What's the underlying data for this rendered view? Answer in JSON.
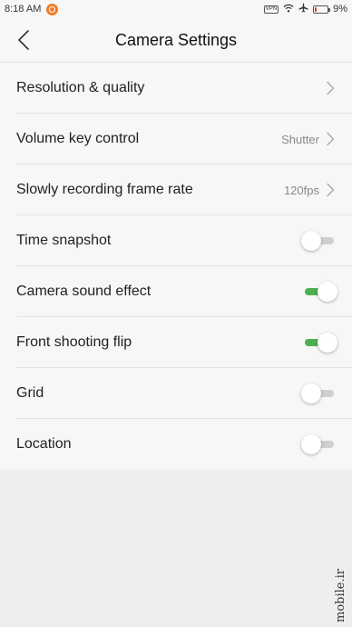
{
  "status_bar": {
    "time": "8:18 AM",
    "vpn_label": "VPN",
    "battery_percent": "9%",
    "battery_level": 0.09,
    "icons": [
      "notification-icon",
      "vpn-icon",
      "wifi-icon",
      "airplane-icon",
      "battery-icon"
    ],
    "notification_color": "#f07c2a",
    "battery_color": "#e53935"
  },
  "header": {
    "title": "Camera Settings",
    "back_icon": "back-chevron-icon"
  },
  "settings": [
    {
      "label": "Resolution & quality",
      "value": "",
      "control": "chevron"
    },
    {
      "label": "Volume key control",
      "value": "Shutter",
      "control": "chevron"
    },
    {
      "label": "Slowly recording frame rate",
      "value": "120fps",
      "control": "chevron"
    },
    {
      "label": "Time snapshot",
      "control": "toggle",
      "on": false
    },
    {
      "label": "Camera sound effect",
      "control": "toggle",
      "on": true
    },
    {
      "label": "Front shooting flip",
      "control": "toggle",
      "on": true
    },
    {
      "label": "Grid",
      "control": "toggle",
      "on": false
    },
    {
      "label": "Location",
      "control": "toggle",
      "on": false
    }
  ],
  "watermark": {
    "text": "mobile.ir"
  },
  "colors": {
    "toggle_on": "#4caf50",
    "toggle_off": "#cfcfcf",
    "background": "#eeeeee",
    "list_background": "#f7f7f7"
  }
}
